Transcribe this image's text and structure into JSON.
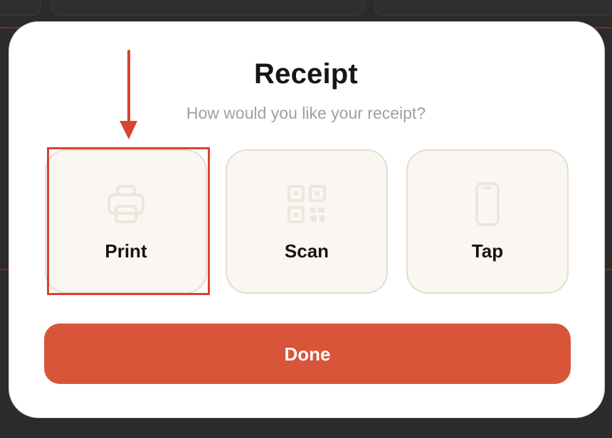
{
  "dialog": {
    "title": "Receipt",
    "subtitle": "How would you like your receipt?"
  },
  "options": [
    {
      "label": "Print",
      "icon": "printer-icon"
    },
    {
      "label": "Scan",
      "icon": "qr-code-icon"
    },
    {
      "label": "Tap",
      "icon": "phone-icon"
    }
  ],
  "done_button": {
    "label": "Done"
  },
  "colors": {
    "accent": "#d8553a",
    "annotation": "#d9432f",
    "option_bg": "#faf6f1",
    "option_border": "#e4dcd1",
    "subtitle": "#9aa2a3"
  }
}
